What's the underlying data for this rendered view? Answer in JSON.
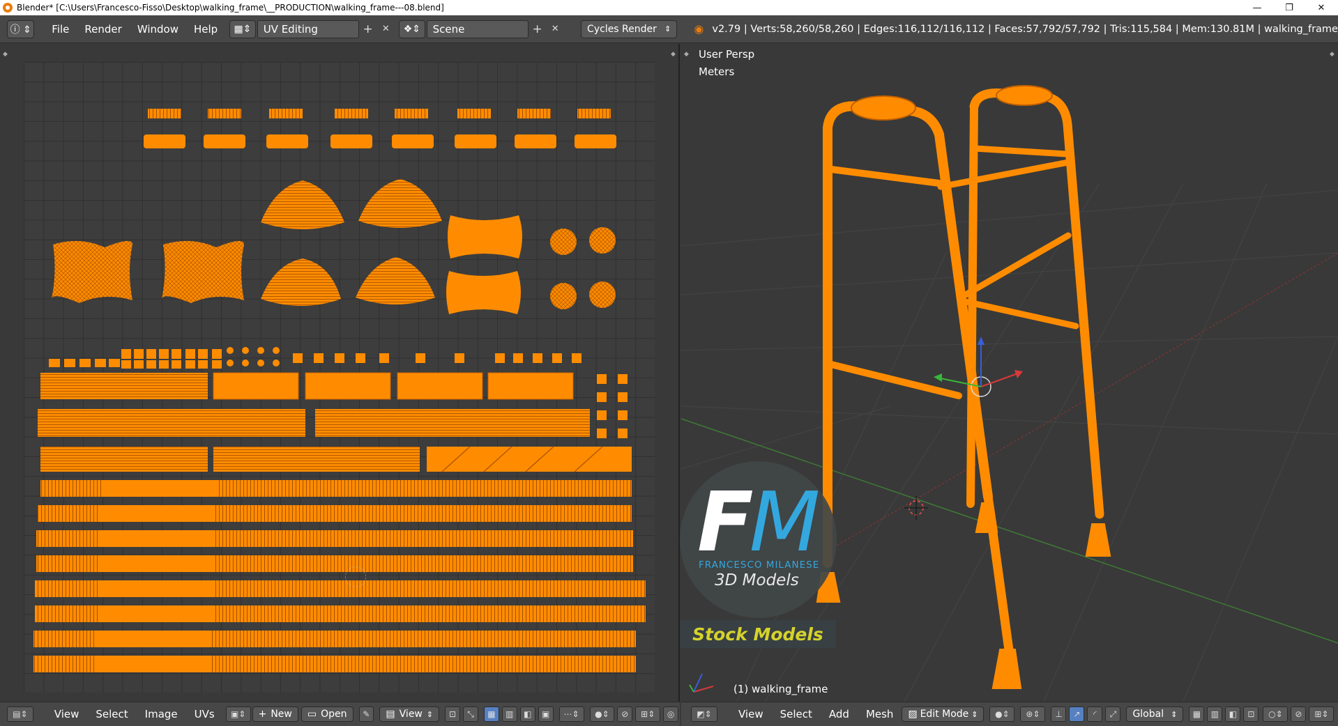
{
  "window": {
    "title": "Blender* [C:\\Users\\Francesco-Fisso\\Desktop\\walking_frame\\__PRODUCTION\\walking_frame---08.blend]",
    "minimize": "—",
    "maximize": "❐",
    "close": "✕"
  },
  "info_header": {
    "menus": [
      "File",
      "Render",
      "Window",
      "Help"
    ],
    "screen_layout": "UV Editing",
    "scene": "Scene",
    "render_engine": "Cycles Render",
    "stats": "v2.79 | Verts:58,260/58,260 | Edges:116,112/116,112 | Faces:57,792/57,792 | Tris:115,584 | Mem:130.81M | walking_frame"
  },
  "uv_editor": {
    "menus": [
      "View",
      "Select",
      "Image",
      "UVs"
    ],
    "new_label": "New",
    "open_label": "Open",
    "view_label": "View"
  },
  "viewport": {
    "view_name": "User Persp",
    "units": "Meters",
    "object_label": "(1) walking_frame",
    "menus": [
      "View",
      "Select",
      "Add",
      "Mesh"
    ],
    "mode": "Edit Mode",
    "orientation": "Global"
  },
  "watermark": {
    "logo_f": "F",
    "logo_m": "M",
    "name": "FRANCESCO MILANESE",
    "subtitle": "3D Models",
    "banner": "Stock Models"
  },
  "colors": {
    "mesh": "#ff8c00",
    "wire": "#c25f00",
    "accent": "#5680c2",
    "panel": "#393939",
    "header": "#474747"
  }
}
